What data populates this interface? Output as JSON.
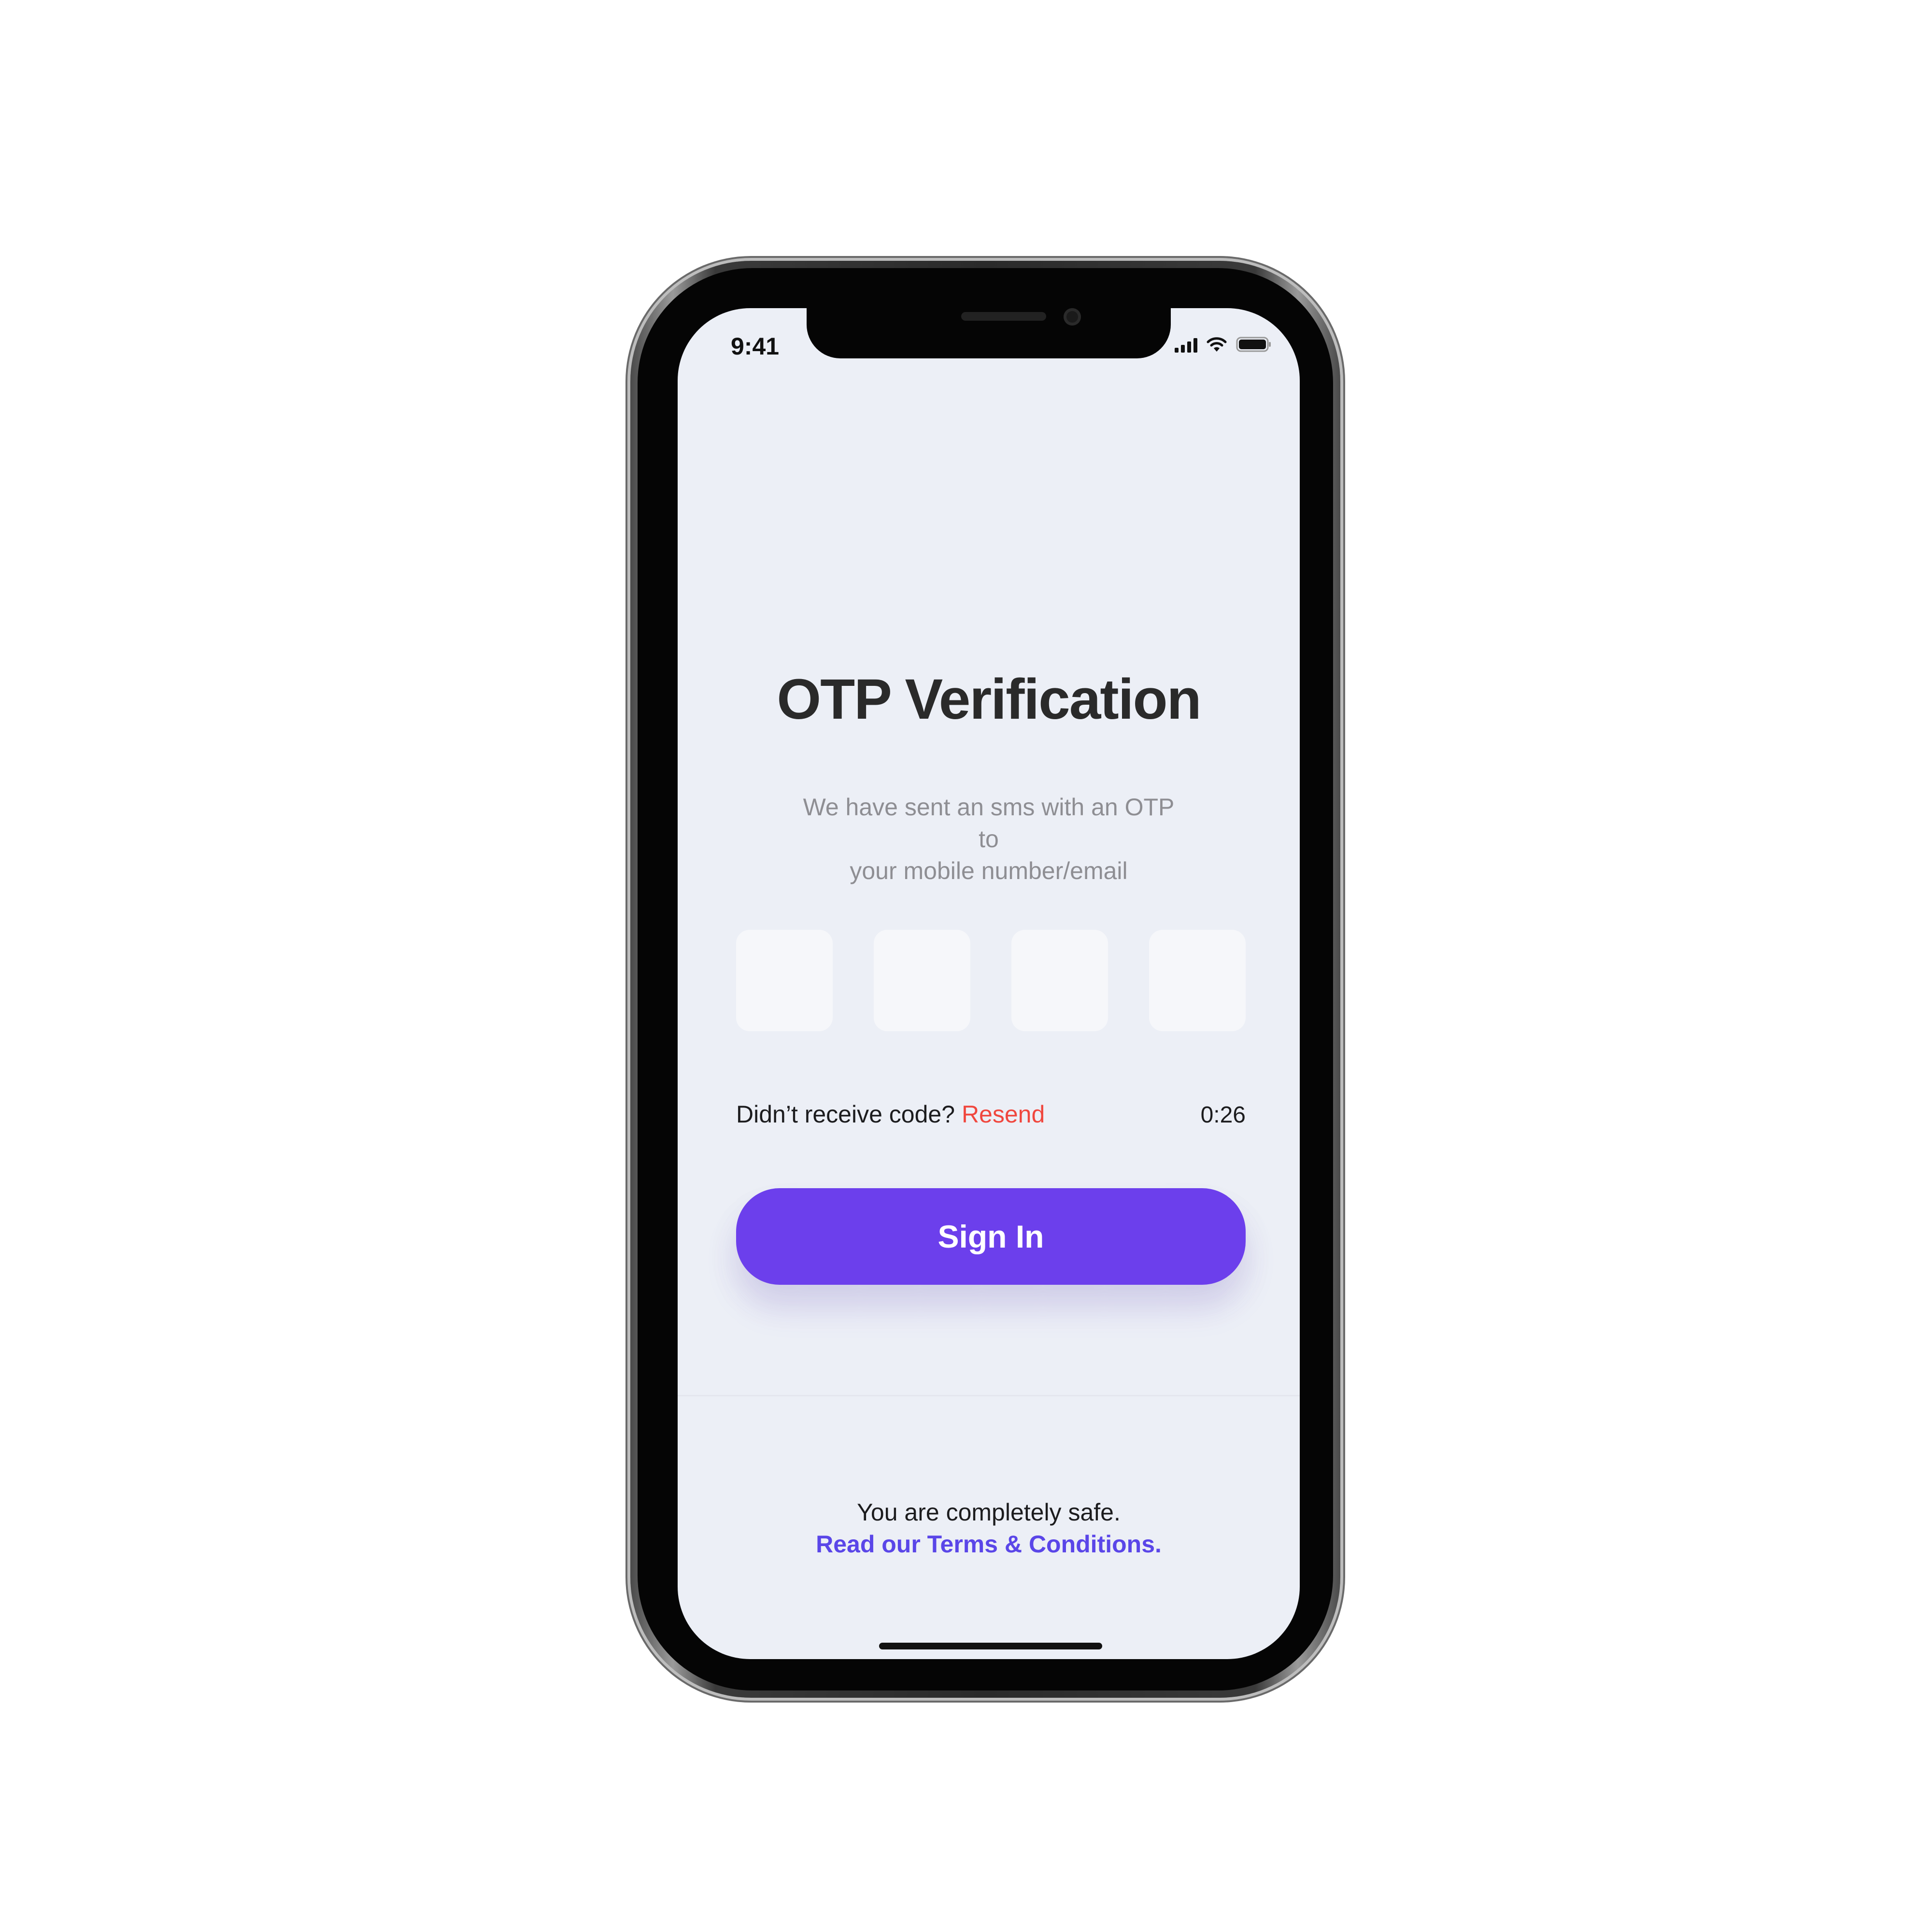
{
  "status_bar": {
    "time": "9:41",
    "icons": [
      "cellular-signal-icon",
      "wifi-icon",
      "battery-icon"
    ]
  },
  "otp_screen": {
    "title": "OTP Verification",
    "subtitle_line1": "We have sent an sms with an OTP to",
    "subtitle_line2": "your mobile number/email",
    "otp_digits": [
      "",
      "",
      "",
      ""
    ],
    "resend_prompt": "Didn’t receive code?",
    "resend_link": "Resend",
    "timer": "0:26",
    "signin_label": "Sign In",
    "footer_safe": "You are completely safe.",
    "footer_terms": "Read our Terms & Conditions."
  },
  "colors": {
    "accent": "#6c3fec",
    "resend": "#f0473e",
    "terms_link": "#5a46e8",
    "screen_background": "#eceff6"
  }
}
